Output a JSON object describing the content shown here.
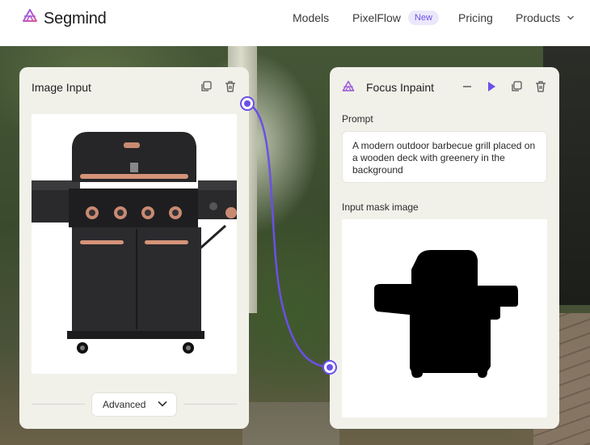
{
  "nav": {
    "brand": "Segmind",
    "items": [
      {
        "label": "Models"
      },
      {
        "label": "PixelFlow",
        "badge": "New"
      },
      {
        "label": "Pricing"
      },
      {
        "label": "Products"
      }
    ]
  },
  "colors": {
    "accent": "#6b50e8",
    "panel_bg": "#f1f1ea",
    "badge_bg": "#ece8fb"
  },
  "left_node": {
    "title": "Image Input",
    "icons": [
      "duplicate-icon",
      "trash-icon"
    ],
    "image_alt": "black gas grill with copper handles",
    "advanced_label": "Advanced"
  },
  "right_node": {
    "title": "Focus Inpaint",
    "icons": [
      "minimize-icon",
      "play-icon",
      "duplicate-icon",
      "trash-icon"
    ],
    "prompt_label": "Prompt",
    "prompt_text": "A modern outdoor barbecue grill placed on a wooden deck with greenery in the background",
    "mask_label": "Input mask image"
  }
}
